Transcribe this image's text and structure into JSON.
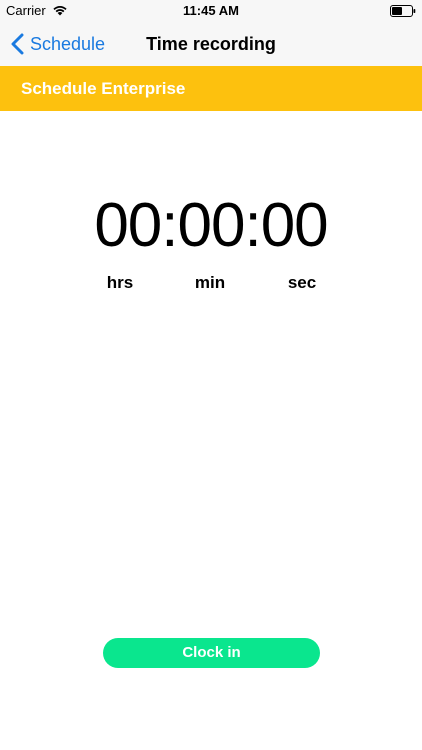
{
  "status_bar": {
    "carrier": "Carrier",
    "time": "11:45 AM",
    "wifi_icon": "wifi-icon",
    "battery_icon": "battery-icon"
  },
  "nav": {
    "back_label": "Schedule",
    "back_icon": "chevron-left-icon",
    "title": "Time recording"
  },
  "banner": {
    "title": "Schedule Enterprise",
    "color": "#fdc10e"
  },
  "timer": {
    "display": "00:00:00",
    "units": {
      "hours": "hrs",
      "minutes": "min",
      "seconds": "sec"
    }
  },
  "actions": {
    "clock_in_label": "Clock in",
    "clock_in_color": "#0ae68e"
  },
  "colors": {
    "accent": "#1a7ae0"
  }
}
